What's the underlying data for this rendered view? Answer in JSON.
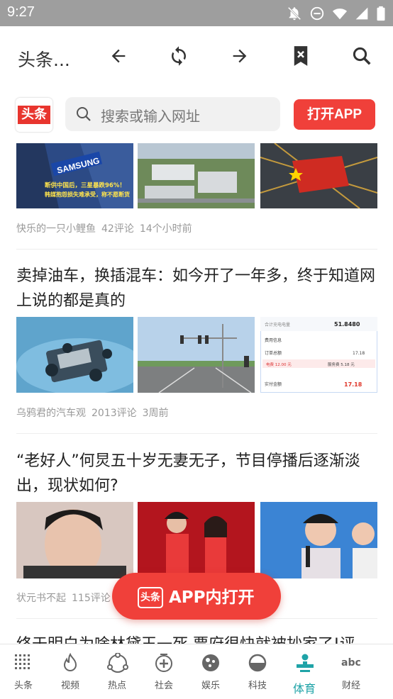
{
  "status_bar": {
    "time": "9:27"
  },
  "top_bar": {
    "title": "头条..."
  },
  "search_row": {
    "logo_text": "头条",
    "search_placeholder": "搜索或输入网址",
    "open_app_label": "打开APP"
  },
  "feed": {
    "articles": [
      {
        "headline": "",
        "image_texts": [
          "SAMSUNG",
          "断供中国后，三星暴跌96%！",
          "韩媒抱怨损失难承受，称不愿断货"
        ],
        "author": "快乐的一只小鲤鱼",
        "comments": "42评论",
        "time": "14个小时前"
      },
      {
        "headline": "卖掉油车，换插混车：如今开了一年多，终于知道网上说的都是真的",
        "image_texts": [
          "合计充电电量",
          "51.8480",
          "费用信息",
          "订单总额",
          "17.18",
          "电费 12.00 元",
          "服务费 5.18 元",
          "实付金额",
          "17.18"
        ],
        "author": "乌鸦君的汽车观",
        "comments": "2013评论",
        "time": "3周前"
      },
      {
        "headline": "“老好人”何炅五十岁无妻无子，节目停播后逐渐淡出，现状如何?",
        "author": "状元书不起",
        "comments": "115评论",
        "time": ""
      },
      {
        "headline": "终于明白为啥林黛玉一死 贾府很快就被抄家了!评"
      }
    ]
  },
  "floating_button": {
    "logo_text": "头条",
    "label": "APP内打开"
  },
  "bottom_tabs": [
    {
      "label": "头条",
      "icon": "grid-icon"
    },
    {
      "label": "视频",
      "icon": "flame-icon"
    },
    {
      "label": "热点",
      "icon": "hotspot-icon"
    },
    {
      "label": "社会",
      "icon": "society-icon"
    },
    {
      "label": "娱乐",
      "icon": "entertainment-icon"
    },
    {
      "label": "科技",
      "icon": "tech-icon"
    },
    {
      "label": "体育",
      "icon": "sports-icon",
      "active": true
    },
    {
      "label": "财经",
      "icon": "abc-icon"
    }
  ],
  "colors": {
    "accent_red": "#f0403a",
    "active_teal": "#1fa3a7",
    "status_bar": "#9e9e9e"
  }
}
